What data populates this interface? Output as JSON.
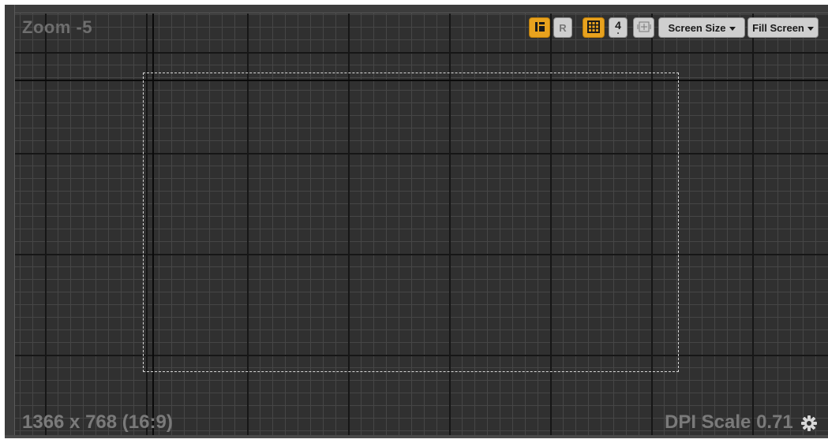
{
  "viewport": {
    "zoom_label": "Zoom -5",
    "resolution_label": "1366 x 768 (16:9)",
    "dpi_label": "DPI Scale 0.71"
  },
  "toolbar": {
    "grid_snap_value": "4",
    "respect_locks_label": "R",
    "screen_size_label": "Screen Size",
    "fill_screen_label": "Fill Screen"
  },
  "icons": {
    "layout_toggle": "layout-toggle-icon",
    "grid": "grid-icon",
    "fit_view": "fit-view-icon",
    "settings": "gear-icon"
  },
  "colors": {
    "accent": "#e8a21e",
    "canvas_bg": "#2f2f2f",
    "button_gray": "#cfcfcf"
  }
}
